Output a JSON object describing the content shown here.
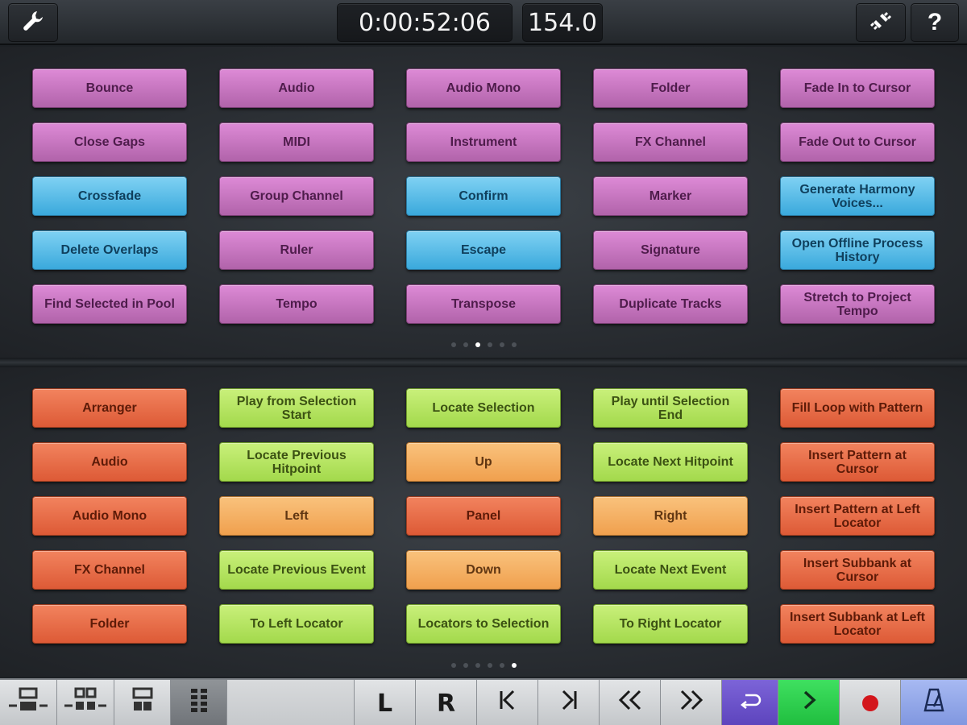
{
  "topbar": {
    "settings_icon": "wrench-icon",
    "time": "0:00:52:06",
    "tempo": "154.0",
    "connect_icon": "connection-plug-icon",
    "help_label": "?"
  },
  "top_panel": {
    "page_count": 6,
    "active_page": 2,
    "rows": [
      [
        {
          "label": "Bounce",
          "color": "pink"
        },
        {
          "label": "Audio",
          "color": "pink"
        },
        {
          "label": "Audio Mono",
          "color": "pink"
        },
        {
          "label": "Folder",
          "color": "pink"
        },
        {
          "label": "Fade In to Cursor",
          "color": "pink"
        }
      ],
      [
        {
          "label": "Close Gaps",
          "color": "pink"
        },
        {
          "label": "MIDI",
          "color": "pink"
        },
        {
          "label": "Instrument",
          "color": "pink"
        },
        {
          "label": "FX Channel",
          "color": "pink"
        },
        {
          "label": "Fade Out to Cursor",
          "color": "pink"
        }
      ],
      [
        {
          "label": "Crossfade",
          "color": "blue"
        },
        {
          "label": "Group Channel",
          "color": "pink"
        },
        {
          "label": "Confirm",
          "color": "blue"
        },
        {
          "label": "Marker",
          "color": "pink"
        },
        {
          "label": "Generate Harmony Voices...",
          "color": "blue"
        }
      ],
      [
        {
          "label": "Delete Overlaps",
          "color": "blue"
        },
        {
          "label": "Ruler",
          "color": "pink"
        },
        {
          "label": "Escape",
          "color": "blue"
        },
        {
          "label": "Signature",
          "color": "pink"
        },
        {
          "label": "Open Offline Process History",
          "color": "blue"
        }
      ],
      [
        {
          "label": "Find Selected in Pool",
          "color": "pink"
        },
        {
          "label": "Tempo",
          "color": "pink"
        },
        {
          "label": "Transpose",
          "color": "pink"
        },
        {
          "label": "Duplicate Tracks",
          "color": "pink"
        },
        {
          "label": "Stretch to Project Tempo",
          "color": "pink"
        }
      ]
    ]
  },
  "bottom_panel": {
    "page_count": 6,
    "active_page": 5,
    "rows": [
      [
        {
          "label": "Arranger",
          "color": "red"
        },
        {
          "label": "Play from Selection Start",
          "color": "green"
        },
        {
          "label": "Locate Selection",
          "color": "green"
        },
        {
          "label": "Play until Selection End",
          "color": "green"
        },
        {
          "label": "Fill Loop with Pattern",
          "color": "red"
        }
      ],
      [
        {
          "label": "Audio",
          "color": "red"
        },
        {
          "label": "Locate Previous Hitpoint",
          "color": "green"
        },
        {
          "label": "Up",
          "color": "orange"
        },
        {
          "label": "Locate Next Hitpoint",
          "color": "green"
        },
        {
          "label": "Insert Pattern at Cursor",
          "color": "red"
        }
      ],
      [
        {
          "label": "Audio Mono",
          "color": "red"
        },
        {
          "label": "Left",
          "color": "orange"
        },
        {
          "label": "Panel",
          "color": "red"
        },
        {
          "label": "Right",
          "color": "orange"
        },
        {
          "label": "Insert Pattern at Left Locator",
          "color": "red"
        }
      ],
      [
        {
          "label": "FX Channel",
          "color": "red"
        },
        {
          "label": "Locate Previous Event",
          "color": "green"
        },
        {
          "label": "Down",
          "color": "orange"
        },
        {
          "label": "Locate Next Event",
          "color": "green"
        },
        {
          "label": "Insert Subbank at Cursor",
          "color": "red"
        }
      ],
      [
        {
          "label": "Folder",
          "color": "red"
        },
        {
          "label": "To Left Locator",
          "color": "green"
        },
        {
          "label": "Locators to Selection",
          "color": "green"
        },
        {
          "label": "To Right Locator",
          "color": "green"
        },
        {
          "label": "Insert Subbank at Left Locator",
          "color": "red"
        }
      ]
    ]
  },
  "bottombar": {
    "layout_icons": [
      "layout-two-panels-icon",
      "layout-four-panels-icon",
      "layout-two-small-icon",
      "layout-grid-icon"
    ],
    "active_layout": 3,
    "left_locator_label": "L",
    "right_locator_label": "R",
    "prev_marker_label": "|<",
    "next_marker_label": ">|",
    "rewind_label": "<<",
    "forward_label": ">>",
    "cycle_icon": "cycle-icon",
    "play_icon": "play-icon",
    "record_icon": "record-icon",
    "metronome_icon": "metronome-icon",
    "colors": {
      "cycle": "#6a51cb",
      "play": "#2fd34f",
      "record": "#d3161c",
      "metronome": "#93a8e8"
    }
  }
}
